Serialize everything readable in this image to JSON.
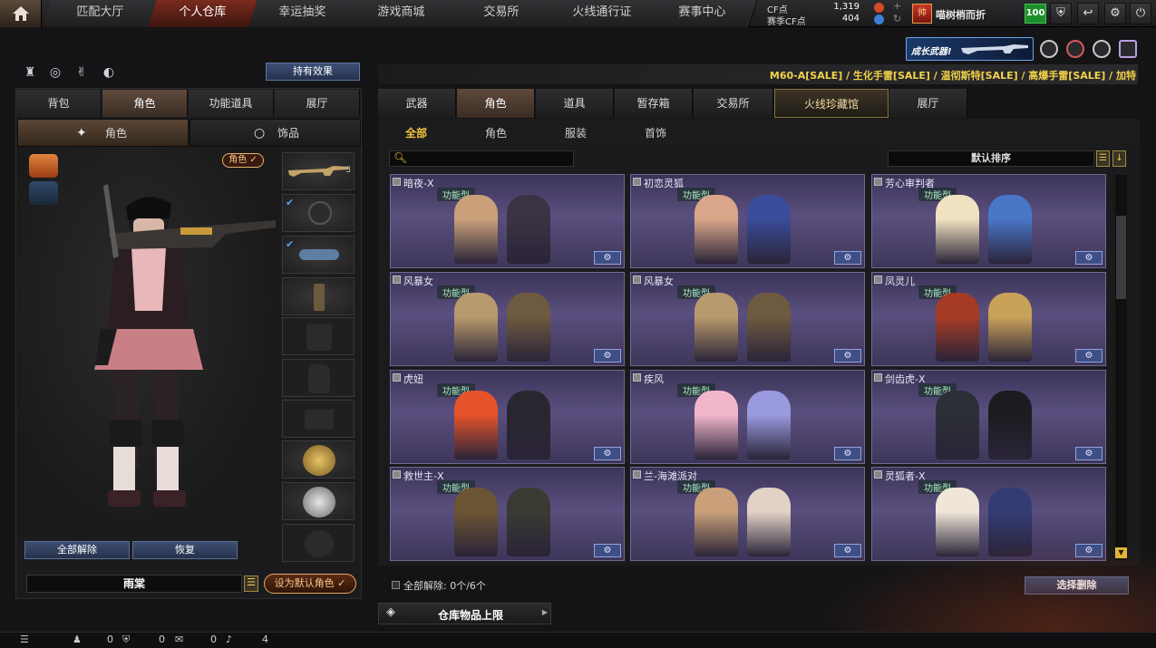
{
  "nav": {
    "tabs": [
      "匹配大厅",
      "个人仓库",
      "幸运抽奖",
      "游戏商城",
      "交易所",
      "火线通行证",
      "赛事中心"
    ],
    "active_tab": "个人仓库"
  },
  "currency": {
    "cf_label": "CF点",
    "cf_value": "1,319",
    "match_cf_label": "赛季CF点",
    "match_cf_value": "404"
  },
  "player": {
    "name": "喵树梢而折",
    "level": "100"
  },
  "promo": {
    "text": "成长武器!"
  },
  "left": {
    "effect_button": "持有效果",
    "tabs": [
      "背包",
      "角色",
      "功能道具",
      "展厅"
    ],
    "active_tab": "角色",
    "subtabs": [
      "角色",
      "饰品"
    ],
    "role_tag": "角色 ✓",
    "weapon_slot_count": "3",
    "release_all_button": "全部解除",
    "restore_button": "恢复",
    "preset_name": "雨棠",
    "set_default_button": "设为默认角色 ✓"
  },
  "ticker": {
    "text": "M60-A[SALE] / 生化手雷[SALE] / 温彻斯特[SALE] / 高爆手雷[SALE] / 加特"
  },
  "right": {
    "tabs": [
      "武器",
      "角色",
      "道具",
      "暂存箱",
      "交易所",
      "火线珍藏馆",
      "展厅"
    ],
    "active_tab": "角色",
    "filters": [
      "全部",
      "角色",
      "服装",
      "首饰"
    ],
    "active_filter": "全部",
    "sort": "默认排序",
    "cards": [
      {
        "name": "暗夜-X",
        "type": "功能型"
      },
      {
        "name": "初恋灵狐",
        "type": "功能型"
      },
      {
        "name": "芳心审判者",
        "type": "功能型"
      },
      {
        "name": "风暴女",
        "type": "功能型"
      },
      {
        "name": "风暴女",
        "type": "功能型"
      },
      {
        "name": "凤灵儿",
        "type": "功能型"
      },
      {
        "name": "虎妞",
        "type": "功能型"
      },
      {
        "name": "疾风",
        "type": "功能型"
      },
      {
        "name": "剑齿虎-X",
        "type": "功能型"
      },
      {
        "name": "救世主-X",
        "type": "功能型"
      },
      {
        "name": "兰-海滩派对",
        "type": "功能型"
      },
      {
        "name": "灵狐者-X",
        "type": "功能型"
      }
    ],
    "release_all_label": "全部解除:",
    "release_all_count": "0个/6个",
    "select_release_button": "选择删除",
    "capacity_label": "仓库物品上限"
  },
  "footer": {
    "friends": "0",
    "shield": "0",
    "chat": "0",
    "volume": "4"
  },
  "colors": {
    "accent_gold": "#f2c43a",
    "active_tab_red": "#7a2a1c",
    "card_purple": "#5a4f7e",
    "button_blue": "#3e4e72"
  }
}
